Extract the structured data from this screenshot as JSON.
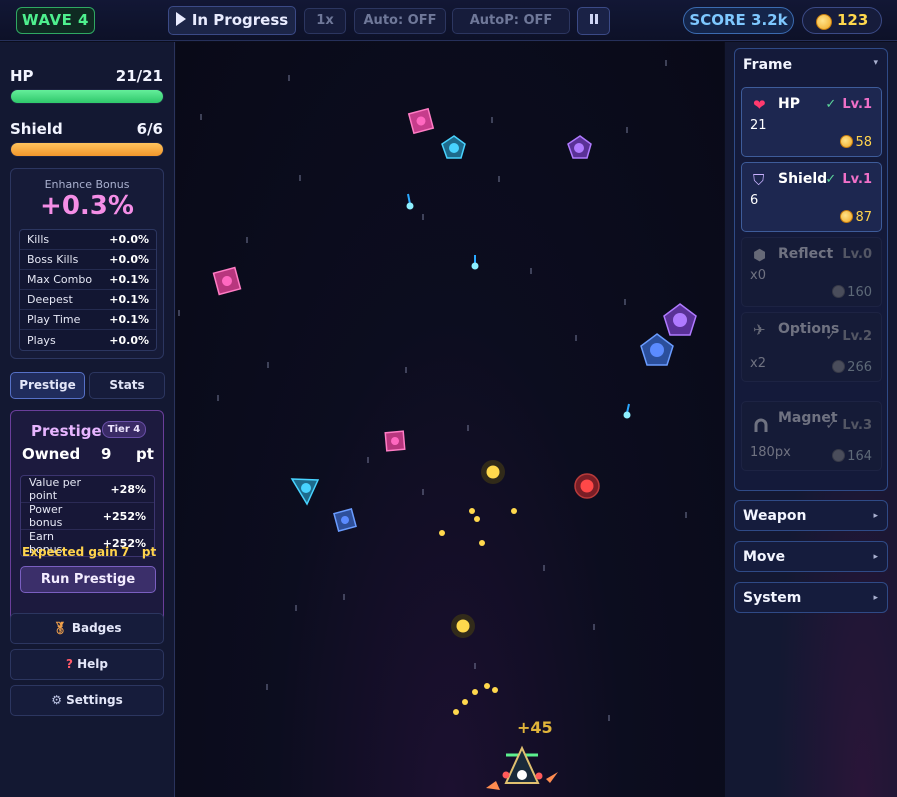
{
  "topbar": {
    "wave": "WAVE 4",
    "status": "In Progress",
    "speed": "1x",
    "auto": "Auto: OFF",
    "autop": "AutoP: OFF",
    "score": "SCORE 3.2k",
    "coins": "123"
  },
  "hp": {
    "label": "HP",
    "value": "21/21",
    "fraction": 1.0
  },
  "shield": {
    "label": "Shield",
    "value": "6/6",
    "fraction": 1.0
  },
  "enhance": {
    "title": "Enhance Bonus",
    "value": "+0.3%",
    "rows": [
      {
        "label": "Kills",
        "value": "+0.0%"
      },
      {
        "label": "Boss Kills",
        "value": "+0.0%"
      },
      {
        "label": "Max Combo",
        "value": "+0.1%"
      },
      {
        "label": "Deepest",
        "value": "+0.1%"
      },
      {
        "label": "Play Time",
        "value": "+0.1%"
      },
      {
        "label": "Plays",
        "value": "+0.0%"
      }
    ]
  },
  "tabs": {
    "prestige": "Prestige",
    "stats": "Stats"
  },
  "prestige": {
    "title": "Prestige",
    "tier": "Tier 4",
    "owned_label": "Owned",
    "owned_value": "9",
    "owned_unit": "pt",
    "rows": [
      {
        "label": "Value per point",
        "value": "+28%"
      },
      {
        "label": "Power bonus",
        "value": "+252%"
      },
      {
        "label": "Earn bonus",
        "value": "+252%"
      }
    ],
    "expected_label": "Expected gain",
    "expected_value": "7",
    "expected_unit": "pt",
    "run_button": "Run Prestige"
  },
  "side_buttons": {
    "badges": "Badges",
    "help": "Help",
    "settings": "Settings"
  },
  "game": {
    "float_text": "+45"
  },
  "shop": {
    "frame_title": "Frame",
    "cards": [
      {
        "name": "HP",
        "icon": "heart-icon",
        "level": "Lv.1",
        "value": "21",
        "cost": "58"
      },
      {
        "name": "Shield",
        "icon": "shield-icon",
        "level": "Lv.1",
        "value": "6",
        "cost": "87"
      },
      {
        "name": "Reflect",
        "icon": "hexagon-icon",
        "level": "Lv.0",
        "value": "x0",
        "cost": "160"
      },
      {
        "name": "Options",
        "icon": "drone-icon",
        "level": "Lv.2",
        "value": "x2",
        "cost": "266"
      },
      {
        "name": "Magnet",
        "icon": "magnet-icon",
        "level": "Lv.3",
        "value": "180px",
        "cost": "164"
      }
    ],
    "sections": [
      "Weapon",
      "Move",
      "System"
    ]
  }
}
